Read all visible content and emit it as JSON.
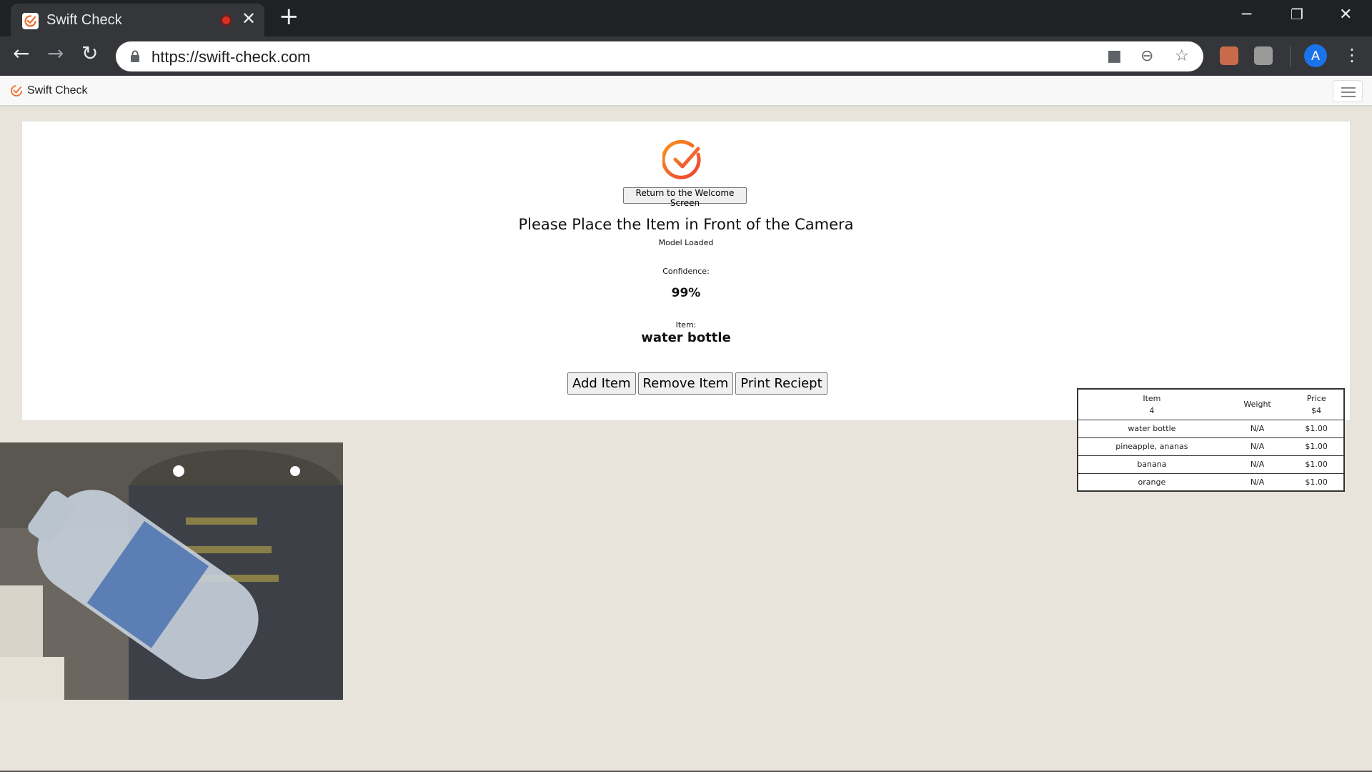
{
  "browser": {
    "tab_title": "Swift Check",
    "tab_close_glyph": "✕",
    "new_tab_glyph": "+",
    "url": "https://swift-check.com",
    "profile_initial": "A"
  },
  "app": {
    "brand": "Swift Check",
    "return_button": "Return to the Welcome Screen",
    "prompt": "Please Place the Item in Front of the Camera",
    "model_status": "Model Loaded",
    "confidence_label": "Confidence:",
    "confidence_value": "99%",
    "item_label": "Item:",
    "item_value": "water bottle",
    "buttons": {
      "add": "Add Item",
      "remove": "Remove Item",
      "print": "Print Reciept"
    }
  },
  "receipt": {
    "headers": {
      "item": "Item",
      "item_count": "4",
      "weight": "Weight",
      "price": "Price",
      "price_total": "$4"
    },
    "rows": [
      {
        "item": "water bottle",
        "weight": "N/A",
        "price": "$1.00"
      },
      {
        "item": "pineapple, ananas",
        "weight": "N/A",
        "price": "$1.00"
      },
      {
        "item": "banana",
        "weight": "N/A",
        "price": "$1.00"
      },
      {
        "item": "orange",
        "weight": "N/A",
        "price": "$1.00"
      }
    ]
  },
  "colors": {
    "brand_orange": "#f26b2a",
    "chrome_dark": "#202124",
    "page_bg": "#e8e4dc"
  }
}
